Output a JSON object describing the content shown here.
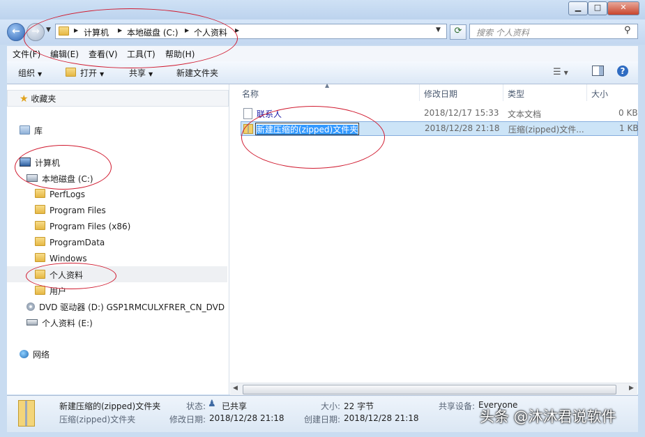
{
  "window": {
    "minimize": "▁",
    "maximize": "□",
    "close": "✕"
  },
  "address": {
    "crumbs": [
      "计算机",
      "本地磁盘 (C:)",
      "个人资料"
    ],
    "search_placeholder": "搜索 个人资料"
  },
  "menu": [
    "文件(F)",
    "编辑(E)",
    "查看(V)",
    "工具(T)",
    "帮助(H)"
  ],
  "toolbar": {
    "organize": "组织",
    "open": "打开",
    "share": "共享",
    "new_folder": "新建文件夹"
  },
  "nav": {
    "favorites": "收藏夹",
    "libraries": "库",
    "computer": "计算机",
    "drive_c": "本地磁盘 (C:)",
    "folders": [
      "PerfLogs",
      "Program Files",
      "Program Files (x86)",
      "ProgramData",
      "Windows",
      "个人资料",
      "用户"
    ],
    "dvd": "DVD 驱动器 (D:) GSP1RMCULXFRER_CN_DVD",
    "drive_e": "个人资料 (E:)",
    "network": "网络"
  },
  "columns": {
    "name": "名称",
    "modified": "修改日期",
    "type": "类型",
    "size": "大小"
  },
  "files": [
    {
      "name": "联系人",
      "modified": "2018/12/17 15:33",
      "type": "文本文档",
      "size": "0 KB"
    },
    {
      "name": "新建压缩的(zipped)文件夹",
      "modified": "2018/12/28 21:18",
      "type": "压缩(zipped)文件...",
      "size": "1 KB"
    }
  ],
  "details": {
    "name": "新建压缩的(zipped)文件夹",
    "kind": "压缩(zipped)文件夹",
    "state_label": "状态:",
    "state_value": "已共享",
    "modified_label": "修改日期:",
    "modified_value": "2018/12/28 21:18",
    "size_label": "大小:",
    "size_value": "22 字节",
    "created_label": "创建日期:",
    "created_value": "2018/12/28 21:18",
    "shared_label": "共享设备:",
    "shared_value": "Everyone"
  },
  "watermark": "头条 @沐沐君说软件",
  "colors": {
    "annotation": "#d0192e",
    "selection": "#cce4f7",
    "link_text": "#1a1aa6"
  }
}
